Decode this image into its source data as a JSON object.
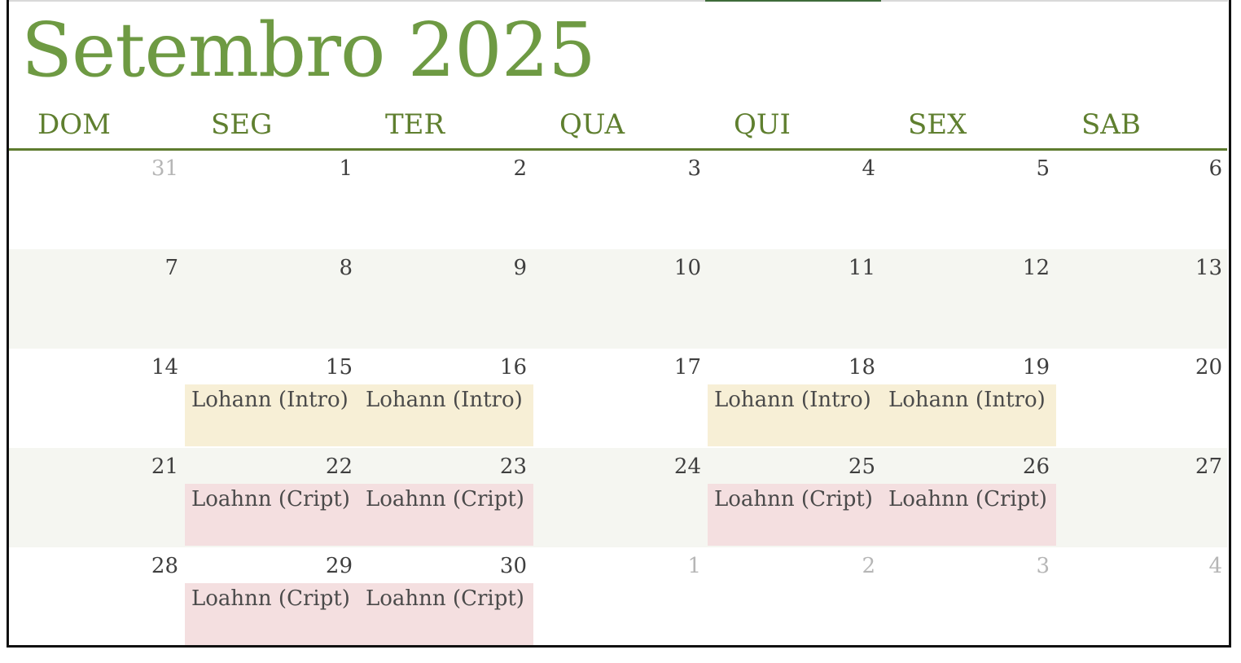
{
  "calendar": {
    "title": "Setembro 2025",
    "colors": {
      "title": "#6e9a43",
      "weekday": "#5f7f2f",
      "rule": "#5e7b2f",
      "shaded_row": "#f5f6f1",
      "intro_event": "#f7efd6",
      "cript_event": "#f4dfe0",
      "muted_day": "#b6b6b6"
    },
    "weekdays": [
      "DOM",
      "SEG",
      "TER",
      "QUA",
      "QUI",
      "SEX",
      "SAB"
    ],
    "weeks": [
      {
        "shaded": false,
        "days": [
          {
            "day": "31",
            "muted": true
          },
          {
            "day": "1",
            "muted": false
          },
          {
            "day": "2",
            "muted": false
          },
          {
            "day": "3",
            "muted": false
          },
          {
            "day": "4",
            "muted": false
          },
          {
            "day": "5",
            "muted": false
          },
          {
            "day": "6",
            "muted": false
          }
        ]
      },
      {
        "shaded": true,
        "days": [
          {
            "day": "7",
            "muted": false
          },
          {
            "day": "8",
            "muted": false
          },
          {
            "day": "9",
            "muted": false
          },
          {
            "day": "10",
            "muted": false
          },
          {
            "day": "11",
            "muted": false
          },
          {
            "day": "12",
            "muted": false
          },
          {
            "day": "13",
            "muted": false
          }
        ]
      },
      {
        "shaded": false,
        "days": [
          {
            "day": "14",
            "muted": false
          },
          {
            "day": "15",
            "muted": false,
            "event": {
              "label": "Lohann (Intro)",
              "kind": "intro"
            }
          },
          {
            "day": "16",
            "muted": false,
            "event": {
              "label": "Lohann (Intro)",
              "kind": "intro"
            }
          },
          {
            "day": "17",
            "muted": false
          },
          {
            "day": "18",
            "muted": false,
            "event": {
              "label": "Lohann (Intro)",
              "kind": "intro"
            }
          },
          {
            "day": "19",
            "muted": false,
            "event": {
              "label": "Lohann (Intro)",
              "kind": "intro"
            }
          },
          {
            "day": "20",
            "muted": false
          }
        ]
      },
      {
        "shaded": true,
        "days": [
          {
            "day": "21",
            "muted": false
          },
          {
            "day": "22",
            "muted": false,
            "event": {
              "label": "Loahnn (Cript)",
              "kind": "cript"
            }
          },
          {
            "day": "23",
            "muted": false,
            "event": {
              "label": "Loahnn (Cript)",
              "kind": "cript"
            }
          },
          {
            "day": "24",
            "muted": false
          },
          {
            "day": "25",
            "muted": false,
            "event": {
              "label": "Loahnn (Cript)",
              "kind": "cript"
            }
          },
          {
            "day": "26",
            "muted": false,
            "event": {
              "label": "Loahnn (Cript)",
              "kind": "cript"
            }
          },
          {
            "day": "27",
            "muted": false
          }
        ]
      },
      {
        "shaded": false,
        "days": [
          {
            "day": "28",
            "muted": false
          },
          {
            "day": "29",
            "muted": false,
            "event": {
              "label": "Loahnn (Cript)",
              "kind": "cript"
            }
          },
          {
            "day": "30",
            "muted": false,
            "event": {
              "label": "Loahnn (Cript)",
              "kind": "cript"
            }
          },
          {
            "day": "1",
            "muted": true
          },
          {
            "day": "2",
            "muted": true
          },
          {
            "day": "3",
            "muted": true
          },
          {
            "day": "4",
            "muted": true
          }
        ]
      }
    ]
  }
}
